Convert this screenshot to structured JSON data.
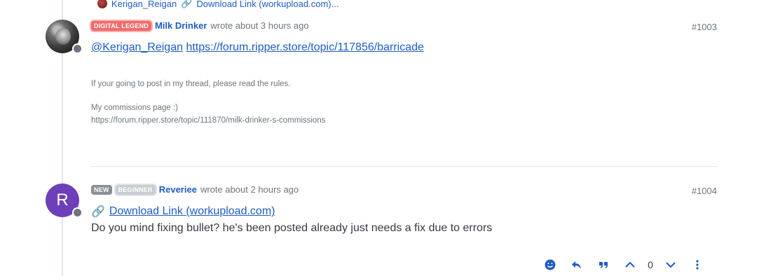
{
  "parent_preview": {
    "username": "Kerigan_Reigan",
    "link_text": "Download Link (workupload.com)..."
  },
  "post1": {
    "badge": "DIGITAL LEGEND",
    "username": "Milk Drinker",
    "meta": "wrote about 3 hours ago",
    "index": "#1003",
    "mention": "@Kerigan_Reigan",
    "url": "https://forum.ripper.store/topic/117856/barricade",
    "signature_line1": "If your going to post in my thread, please read the rules.",
    "signature_line2": "My commissions page :)",
    "signature_line3": "https://forum.ripper.store/topic/111870/milk-drinker-s-commissions"
  },
  "post2": {
    "avatar_letter": "R",
    "badge_new": "NEW",
    "badge_beginner": "BEGINNER",
    "username": "Reveriee",
    "meta": "wrote about 2 hours ago",
    "index": "#1004",
    "link_text": "Download Link (workupload.com)",
    "body": "Do you mind fixing bullet? he's been posted already just needs a fix due to errors"
  },
  "actions": {
    "vote_count": "0",
    "icons": [
      "smile-icon",
      "reply-icon",
      "quote-icon",
      "upvote-icon",
      "downvote-icon",
      "more-icon"
    ]
  },
  "colors": {
    "link": "#1f5cc2",
    "legend_badge": "#f26a6a",
    "avatar_purple": "#6e3fb9",
    "status_offline": "#6c757d"
  }
}
